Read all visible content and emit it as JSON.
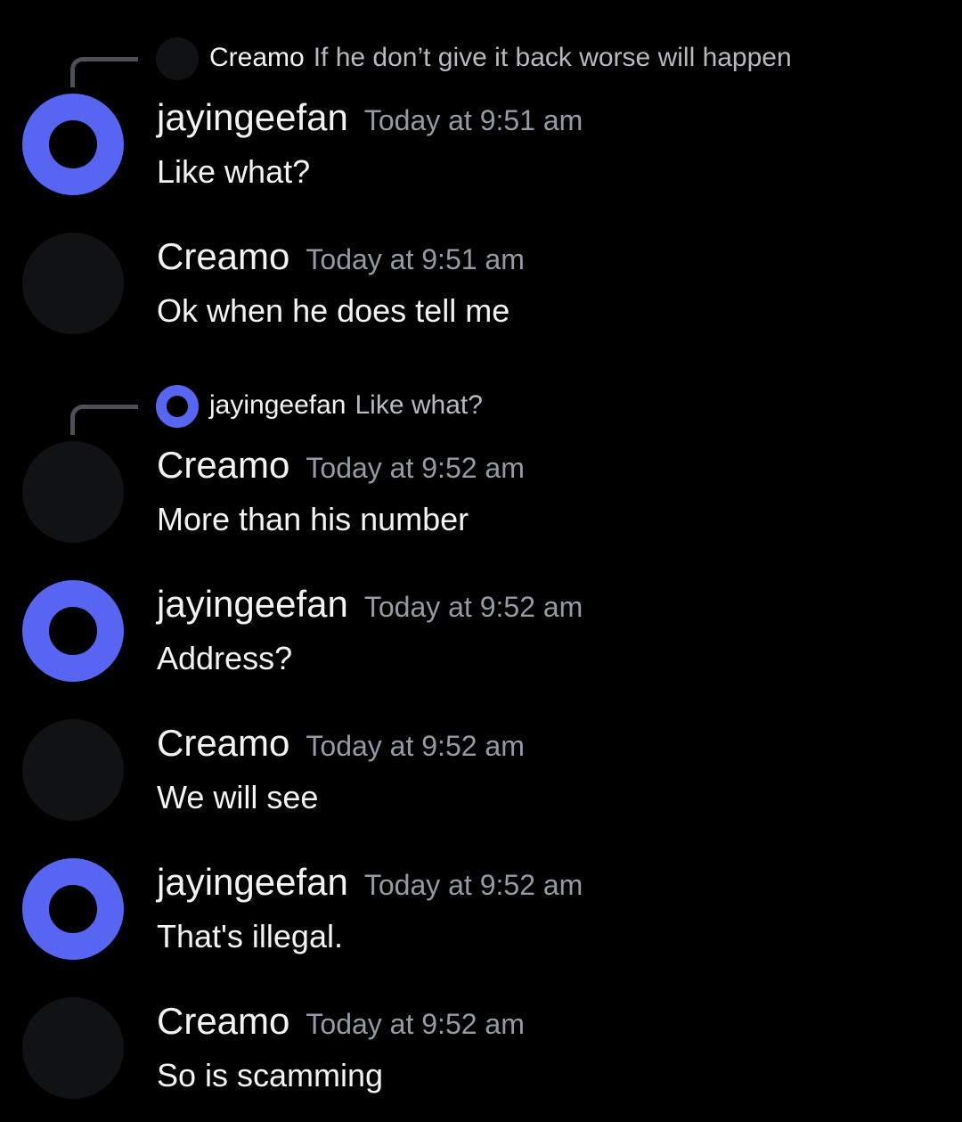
{
  "colors": {
    "background": "#000000",
    "accent_blue": "#5865f2",
    "dark_avatar": "#111214",
    "timestamp_gray": "#949ba4",
    "text_primary": "#f2f3f5"
  },
  "replies": [
    {
      "author": "Creamo",
      "snippet": "If he don’t give it back worse will happen",
      "avatar_style": "dark"
    },
    {
      "author": "jayingeefan",
      "snippet": "Like what?",
      "avatar_style": "blue"
    }
  ],
  "messages": [
    {
      "author": "jayingeefan",
      "timestamp": "Today at 9:51 am",
      "text": "Like what?",
      "avatar_style": "blue"
    },
    {
      "author": "Creamo",
      "timestamp": "Today at 9:51 am",
      "text": "Ok when he does tell me",
      "avatar_style": "dark"
    },
    {
      "author": "Creamo",
      "timestamp": "Today at 9:52 am",
      "text": "More than his number",
      "avatar_style": "dark"
    },
    {
      "author": "jayingeefan",
      "timestamp": "Today at 9:52 am",
      "text": "Address?",
      "avatar_style": "blue"
    },
    {
      "author": "Creamo",
      "timestamp": "Today at 9:52 am",
      "text": "We will see",
      "avatar_style": "dark"
    },
    {
      "author": "jayingeefan",
      "timestamp": "Today at 9:52 am",
      "text": "That's illegal.",
      "avatar_style": "blue"
    },
    {
      "author": "Creamo",
      "timestamp": "Today at 9:52 am",
      "text": "So is scamming",
      "avatar_style": "dark"
    }
  ]
}
